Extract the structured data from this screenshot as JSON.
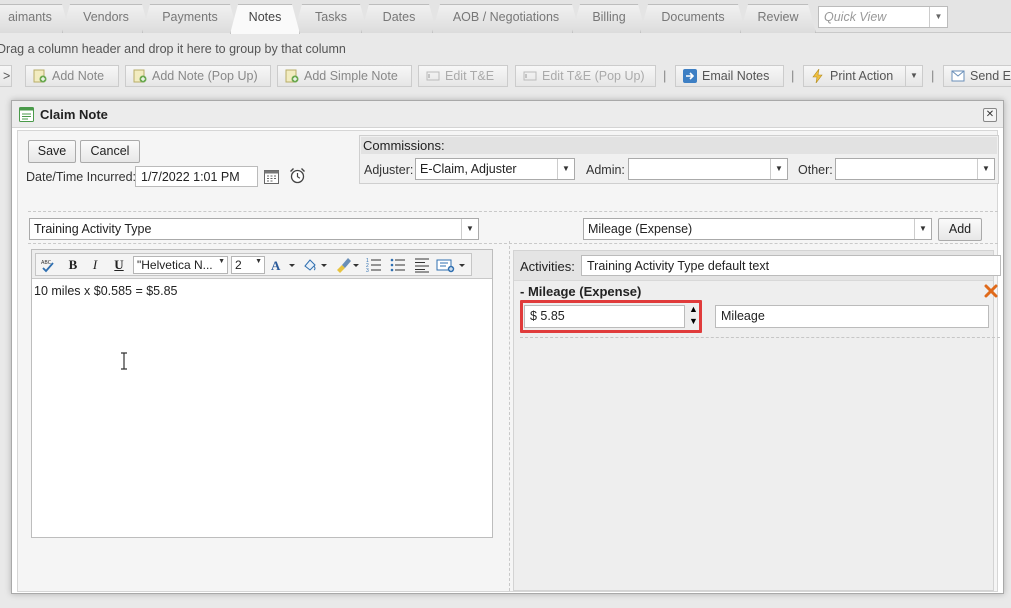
{
  "tabs": {
    "claimants": "aimants",
    "vendors": "Vendors",
    "payments": "Payments",
    "notes": "Notes",
    "tasks": "Tasks",
    "dates": "Dates",
    "aob": "AOB / Negotiations",
    "billing": "Billing",
    "documents": "Documents",
    "review": "Review"
  },
  "quick_view_placeholder": "Quick View",
  "group_hint": "Drag a column header and drop it here to group by that column",
  "toolbar": {
    "collapse": ">",
    "add_note": "Add Note",
    "add_note_popup": "Add Note (Pop Up)",
    "add_simple_note": "Add Simple Note",
    "edit_te": "Edit T&E",
    "edit_te_popup": "Edit T&E (Pop Up)",
    "email_notes": "Email Notes",
    "print_action": "Print Action",
    "send": "Send E",
    "sep": "|"
  },
  "dialog": {
    "title": "Claim Note",
    "save": "Save",
    "cancel": "Cancel",
    "datetime_label": "Date/Time Incurred:",
    "datetime_value": "1/7/2022 1:01 PM",
    "commissions": {
      "header": "Commissions:",
      "adjuster_label": "Adjuster:",
      "adjuster_value": "E-Claim, Adjuster",
      "admin_label": "Admin:",
      "admin_value": "",
      "other_label": "Other:",
      "other_value": ""
    },
    "activity_type_value": "Training Activity Type",
    "expense_type_value": "Mileage (Expense)",
    "add_button": "Add",
    "editor": {
      "font_name": "\"Helvetica N...",
      "font_size": "2",
      "content": "10 miles x $0.585 = $5.85"
    },
    "activities": {
      "label": "Activities:",
      "value": "Training Activity Type default text",
      "mileage_title": "- Mileage (Expense)",
      "amount_value": "$ 5.85",
      "description_value": "Mileage"
    }
  }
}
